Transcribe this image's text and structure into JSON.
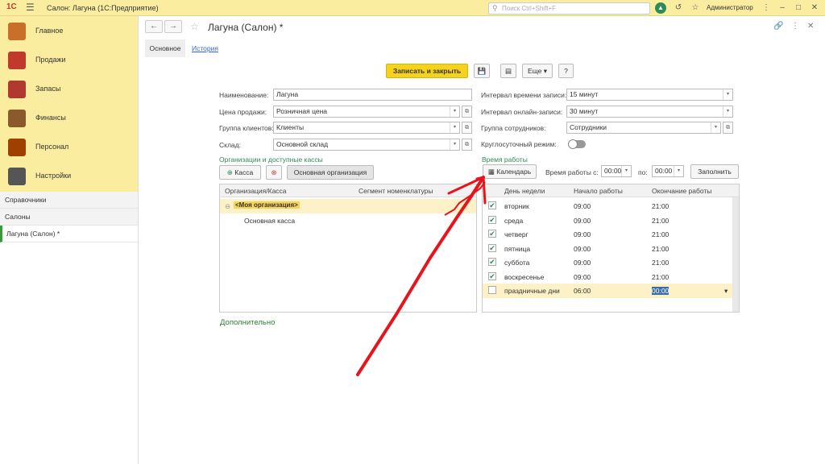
{
  "titlebar": {
    "logo": "1С",
    "title": "Салон: Лагуна  (1С:Предприятие)",
    "search_placeholder": "Поиск Ctrl+Shift+F",
    "user": "Администратор"
  },
  "sidebar": {
    "sections": [
      {
        "label": "Главное",
        "icon": "clipboard-icon",
        "color": "#c8702a"
      },
      {
        "label": "Продажи",
        "icon": "chart-icon",
        "color": "#c0392b"
      },
      {
        "label": "Запасы",
        "icon": "box-icon",
        "color": "#b03a2e"
      },
      {
        "label": "Финансы",
        "icon": "wallet-icon",
        "color": "#8a5a2b"
      },
      {
        "label": "Персонал",
        "icon": "people-icon",
        "color": "#a04000"
      },
      {
        "label": "Настройки",
        "icon": "gear-icon",
        "color": "#555555"
      }
    ],
    "nav": [
      "Справочники",
      "Салоны",
      "Лагуна (Салон) *"
    ]
  },
  "header": {
    "title": "Лагуна (Салон) *",
    "tab_main": "Основное",
    "tab_history": "История"
  },
  "toolbar": {
    "save_close": "Записать и закрыть",
    "more": "Еще",
    "help": "?"
  },
  "form": {
    "name_label": "Наименование:",
    "name_value": "Лагуна",
    "price_label": "Цена продажи:",
    "price_value": "Розничная цена",
    "clients_label": "Группа клиентов:",
    "clients_value": "Клиенты",
    "warehouse_label": "Склад:",
    "warehouse_value": "Основной склад",
    "interval_label": "Интервал времени записи:",
    "interval_value": "15 минут",
    "online_label": "Интервал онлайн-записи:",
    "online_value": "30 минут",
    "staff_label": "Группа сотрудников:",
    "staff_value": "Сотрудники",
    "roundclock_label": "Круглосуточный режим:"
  },
  "orgs": {
    "title": "Организации и доступные кассы",
    "add_button": "Касса",
    "main_org_button": "Основная организация",
    "col1": "Организация/Касса",
    "col2": "Сегмент номенклатуры",
    "rows": [
      {
        "org": "<Моя организация>"
      },
      {
        "kassa": "Основная касса"
      }
    ]
  },
  "worktime": {
    "title": "Время работы",
    "calendar_button": "Календарь",
    "from_label": "Время работы с:",
    "from_value": "00:00",
    "to_label": "по:",
    "to_value": "00:00",
    "fill_button": "Заполнить",
    "col_day": "День недели",
    "col_start": "Начало работы",
    "col_end": "Окончание работы",
    "rows": [
      {
        "checked": "✔",
        "day": "вторник",
        "start": "09:00",
        "end": "21:00"
      },
      {
        "checked": "✔",
        "day": "среда",
        "start": "09:00",
        "end": "21:00"
      },
      {
        "checked": "✔",
        "day": "четверг",
        "start": "09:00",
        "end": "21:00"
      },
      {
        "checked": "✔",
        "day": "пятница",
        "start": "09:00",
        "end": "21:00"
      },
      {
        "checked": "✔",
        "day": "суббота",
        "start": "09:00",
        "end": "21:00"
      },
      {
        "checked": "✔",
        "day": "воскресенье",
        "start": "09:00",
        "end": "21:00"
      },
      {
        "checked": "",
        "day": "праздничные дни",
        "start": "06:00",
        "end": "00:00"
      }
    ]
  },
  "additional": "Дополнительно",
  "colors": {
    "accent": "#f6d21c",
    "link": "#3366cc",
    "green": "#2e8b57",
    "annotation": "#e8141c"
  }
}
